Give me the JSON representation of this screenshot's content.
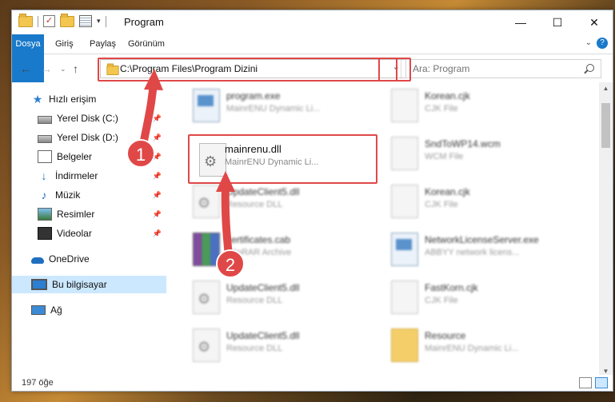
{
  "window": {
    "title": "Program"
  },
  "ribbon": {
    "tabs": [
      "Dosya",
      "Giriş",
      "Paylaş",
      "Görünüm"
    ]
  },
  "address": {
    "path": "C:\\Program Files\\Program Dizini"
  },
  "search": {
    "placeholder": "Ara: Program"
  },
  "nav": {
    "items": [
      {
        "label": "Hızlı erişim",
        "icon": "star-icon"
      },
      {
        "label": "Yerel Disk (C:)",
        "icon": "drive-icon",
        "pinned": true
      },
      {
        "label": "Yerel Disk (D:)",
        "icon": "drive-icon",
        "pinned": true
      },
      {
        "label": "Belgeler",
        "icon": "documents-icon",
        "pinned": true
      },
      {
        "label": "İndirmeler",
        "icon": "download-icon",
        "pinned": true
      },
      {
        "label": "Müzik",
        "icon": "music-icon",
        "pinned": true
      },
      {
        "label": "Resimler",
        "icon": "pictures-icon",
        "pinned": true
      },
      {
        "label": "Videolar",
        "icon": "videos-icon",
        "pinned": true
      },
      {
        "label": "OneDrive",
        "icon": "cloud-icon"
      },
      {
        "label": "Bu bilgisayar",
        "icon": "computer-icon",
        "selected": true
      },
      {
        "label": "Ağ",
        "icon": "network-icon"
      }
    ]
  },
  "files": [
    {
      "name": "program.exe",
      "desc": "MainrENU Dynamic Li...",
      "icon": "setup"
    },
    {
      "name": "Korean.cjk",
      "desc": "CJK File",
      "icon": "blank"
    },
    {
      "name": "mainrenu.dll",
      "desc": "MainrENU Dynamic Li...",
      "icon": "gear"
    },
    {
      "name": "SndToWP14.wcm",
      "desc": "WCM File",
      "icon": "blank"
    },
    {
      "name": "UpdateClient5.dll",
      "desc": "Resource DLL",
      "icon": "gear"
    },
    {
      "name": "Korean.cjk",
      "desc": "CJK File",
      "icon": "blank"
    },
    {
      "name": "certificates.cab",
      "desc": "WinRAR Archive",
      "icon": "rar"
    },
    {
      "name": "NetworkLicenseServer.exe",
      "desc": "ABBYY network licens...",
      "icon": "exe"
    },
    {
      "name": "UpdateClient5.dll",
      "desc": "Resource DLL",
      "icon": "gear"
    },
    {
      "name": "FastKorn.cjk",
      "desc": "CJK File",
      "icon": "blank"
    },
    {
      "name": "UpdateClient5.dll",
      "desc": "Resource DLL",
      "icon": "gear"
    },
    {
      "name": "Resource",
      "desc": "MainrENU Dynamic Li...",
      "icon": "folder"
    }
  ],
  "status": {
    "count": "197 öğe"
  },
  "callouts": [
    "1",
    "2"
  ],
  "colors": {
    "accent": "#1979ca",
    "highlight": "#e04848",
    "selected": "#cce8ff"
  }
}
